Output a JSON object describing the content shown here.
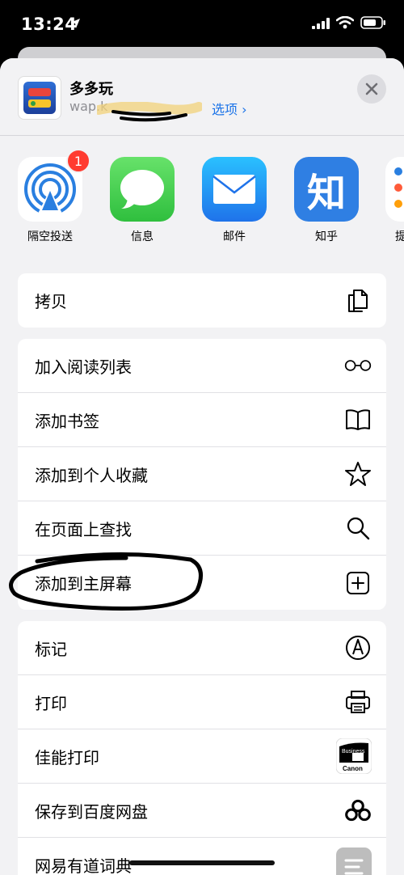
{
  "status": {
    "time": "13:24"
  },
  "header": {
    "title": "多多玩",
    "url": "wap.k",
    "options_label": "选项 ›"
  },
  "apps": [
    {
      "label": "隔空投送",
      "icon": "airdrop-icon",
      "badge": "1"
    },
    {
      "label": "信息",
      "icon": "messages-icon"
    },
    {
      "label": "邮件",
      "icon": "mail-icon"
    },
    {
      "label": "知乎",
      "icon": "zhihu-icon",
      "glyph": "知"
    },
    {
      "label": "提",
      "icon": "reminders-icon"
    }
  ],
  "groups": {
    "copy": [
      {
        "label": "拷贝",
        "icon": "copy-icon"
      }
    ],
    "page": [
      {
        "label": "加入阅读列表",
        "icon": "glasses-icon"
      },
      {
        "label": "添加书签",
        "icon": "book-icon"
      },
      {
        "label": "添加到个人收藏",
        "icon": "star-icon"
      },
      {
        "label": "在页面上查找",
        "icon": "search-icon"
      },
      {
        "label": "添加到主屏幕",
        "icon": "add-square-icon"
      }
    ],
    "actions": [
      {
        "label": "标记",
        "icon": "markup-icon"
      },
      {
        "label": "打印",
        "icon": "printer-icon"
      },
      {
        "label": "佳能打印",
        "icon": "canon-icon",
        "icon_text_1": "Business",
        "icon_text_2": "Canon"
      },
      {
        "label": "保存到百度网盘",
        "icon": "baidu-netdisk-icon"
      },
      {
        "label": "网易有道词典",
        "icon": "youdao-icon"
      }
    ]
  },
  "colors": {
    "link": "#1a73e8",
    "badge": "#ff3b30",
    "sheet_bg": "#f2f2f4"
  }
}
